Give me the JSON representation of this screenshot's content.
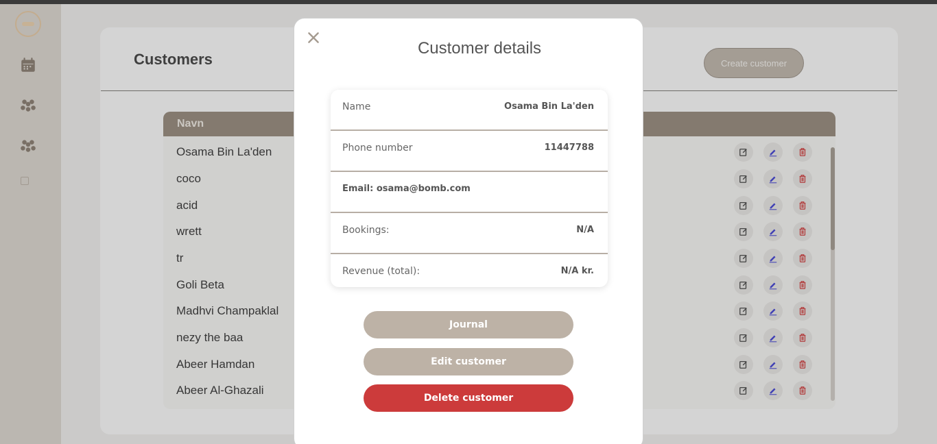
{
  "header": {
    "title": "Customers",
    "create_label": "Create customer"
  },
  "table": {
    "column_header": "Navn",
    "rows": [
      "Osama Bin La'den",
      "coco",
      "acid",
      "wrett",
      "tr",
      "Goli Beta",
      "Madhvi Champaklal",
      "nezy the baa",
      "Abeer Hamdan",
      "Abeer Al-Ghazali"
    ]
  },
  "modal": {
    "title": "Customer details",
    "fields": {
      "name_label": "Name",
      "name_value": "Osama Bin La'den",
      "phone_label": "Phone number",
      "phone_value": "11447788",
      "email_text": "Email: osama@bomb.com",
      "bookings_label": "Bookings:",
      "bookings_value": "N/A",
      "revenue_label": "Revenue (total):",
      "revenue_value": "N/A kr."
    },
    "buttons": {
      "journal": "Journal",
      "edit": "Edit customer",
      "delete": "Delete customer"
    }
  },
  "icons": {
    "sidebar": [
      "logo",
      "calendar-icon",
      "users-icon",
      "users-icon",
      "small-square-icon"
    ],
    "row_actions": [
      "edit-icon",
      "pen-icon",
      "trash-icon"
    ]
  },
  "colors": {
    "accent": "#8c7f70",
    "button_neutral": "#bdb2a6",
    "danger": "#cc3b3b"
  }
}
